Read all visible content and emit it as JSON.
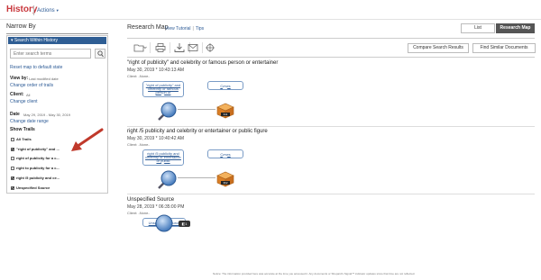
{
  "header": {
    "app_title": "History",
    "actions_label": "Actions",
    "actions_icon": "chevron-down-icon"
  },
  "sidebar": {
    "title": "Narrow By",
    "search_header": "Search Within History",
    "search_placeholder": "Enter search terms",
    "reset_link": "Reset map to default state",
    "view_by_label": "View by:",
    "view_by_value": "Last modified date",
    "change_order_link": "Change order of trails",
    "client_label": "Client:",
    "client_value": "All",
    "change_client_link": "Change client",
    "date_label": "Date",
    "date_value": "May 29, 2019 - May 30, 2019",
    "change_date_link": "Change date range",
    "show_trails_label": "Show Trails",
    "trails": [
      {
        "label": "All Trails",
        "checked": false
      },
      {
        "label": "\"right of publicity\" and ...",
        "checked": true
      },
      {
        "label": "right of publicity for a c...",
        "checked": false
      },
      {
        "label": "right to publicity for a c...",
        "checked": false
      },
      {
        "label": "right /5 publicity and ce...",
        "checked": true
      },
      {
        "label": "Unspecified Source",
        "checked": true
      }
    ]
  },
  "main": {
    "title": "Research Map",
    "view_tutorial": "View Tutorial",
    "separator": "|",
    "tips": "Tips",
    "list_button": "List",
    "research_map_button": "Research Map",
    "compare_button": "Compare Search Results",
    "similar_button": "Find Similar Documents",
    "trails": [
      {
        "title": "\"right of publicity\" and celebrity or famous person or entertainer",
        "date": "May 30, 2019 * 10:43:13 AM",
        "client": "Client: -None-",
        "search_bubble": "\"right of publicity\" and celebrity or famous person or",
        "cases_label": "Cases",
        "box_count": "311"
      },
      {
        "title": "right /5 publicity and celebrity or entertainer or public figure",
        "date": "May 30, 2019 * 10:40:42 AM",
        "client": "Client: -None-",
        "search_bubble": "right /5 publicity and celebrity or entertainer or public",
        "cases_label": "Cases",
        "box_count": "362"
      },
      {
        "title": "Unspecified Source",
        "date": "May 28, 2019 * 06:35:00 PM",
        "client": "Client: -None-",
        "search_bubble": "Unspecified Source",
        "badge": "1"
      }
    ],
    "notice": "Notice: The information provided here was accurate at the time you accessed it. Any documents or Shepard's Signal™ indicator updates since that time are not reflected."
  },
  "colors": {
    "brand_red": "#c8363b",
    "link_blue": "#2d5b96",
    "panel_header": "#2f5e94",
    "box_orange": "#e08a2c",
    "arrow_red": "#c0392b"
  }
}
